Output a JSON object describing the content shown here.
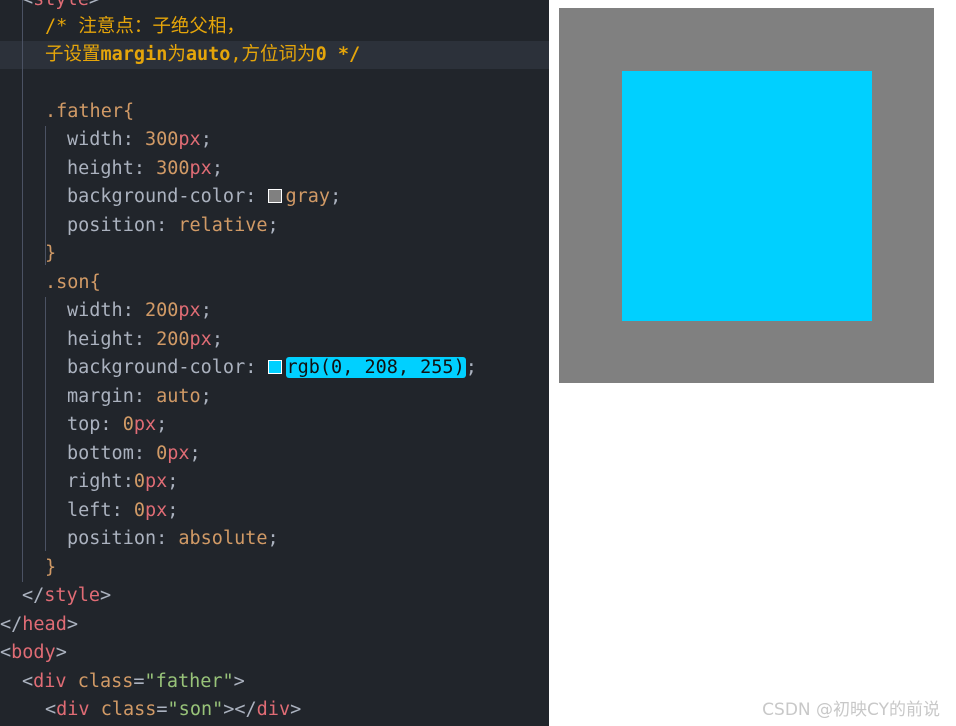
{
  "colors": {
    "editor_bg": "#21252b",
    "father": "#808080",
    "son": "#00d0ff"
  },
  "code": {
    "l0_tag": "style",
    "l1": "/* 注意点：子绝父相，",
    "l2_a": "子设置",
    "l2_b": "margin",
    "l2_c": "为",
    "l2_d": "auto",
    "l2_e": ",方位词为",
    "l2_f": "0",
    "l2_g": " */",
    "father_sel": ".father",
    "son_sel": ".son",
    "prop_width": "width",
    "prop_height": "height",
    "prop_bg": "background-color",
    "prop_position": "position",
    "prop_margin": "margin",
    "prop_top": "top",
    "prop_bottom": "bottom",
    "prop_right": "right",
    "prop_left": "left",
    "n300": "300",
    "n200": "200",
    "n0": "0",
    "unit_px": "px",
    "val_gray": "gray",
    "val_relative": "relative",
    "val_auto": "auto",
    "val_absolute": "absolute",
    "val_rgb": "rgb(0, 208, 255)",
    "tag_style": "style",
    "tag_head": "head",
    "tag_body": "body",
    "tag_div": "div",
    "attr_class": "class",
    "str_father": "\"father\"",
    "str_son": "\"son\""
  },
  "watermark": "CSDN @初映CY的前说"
}
